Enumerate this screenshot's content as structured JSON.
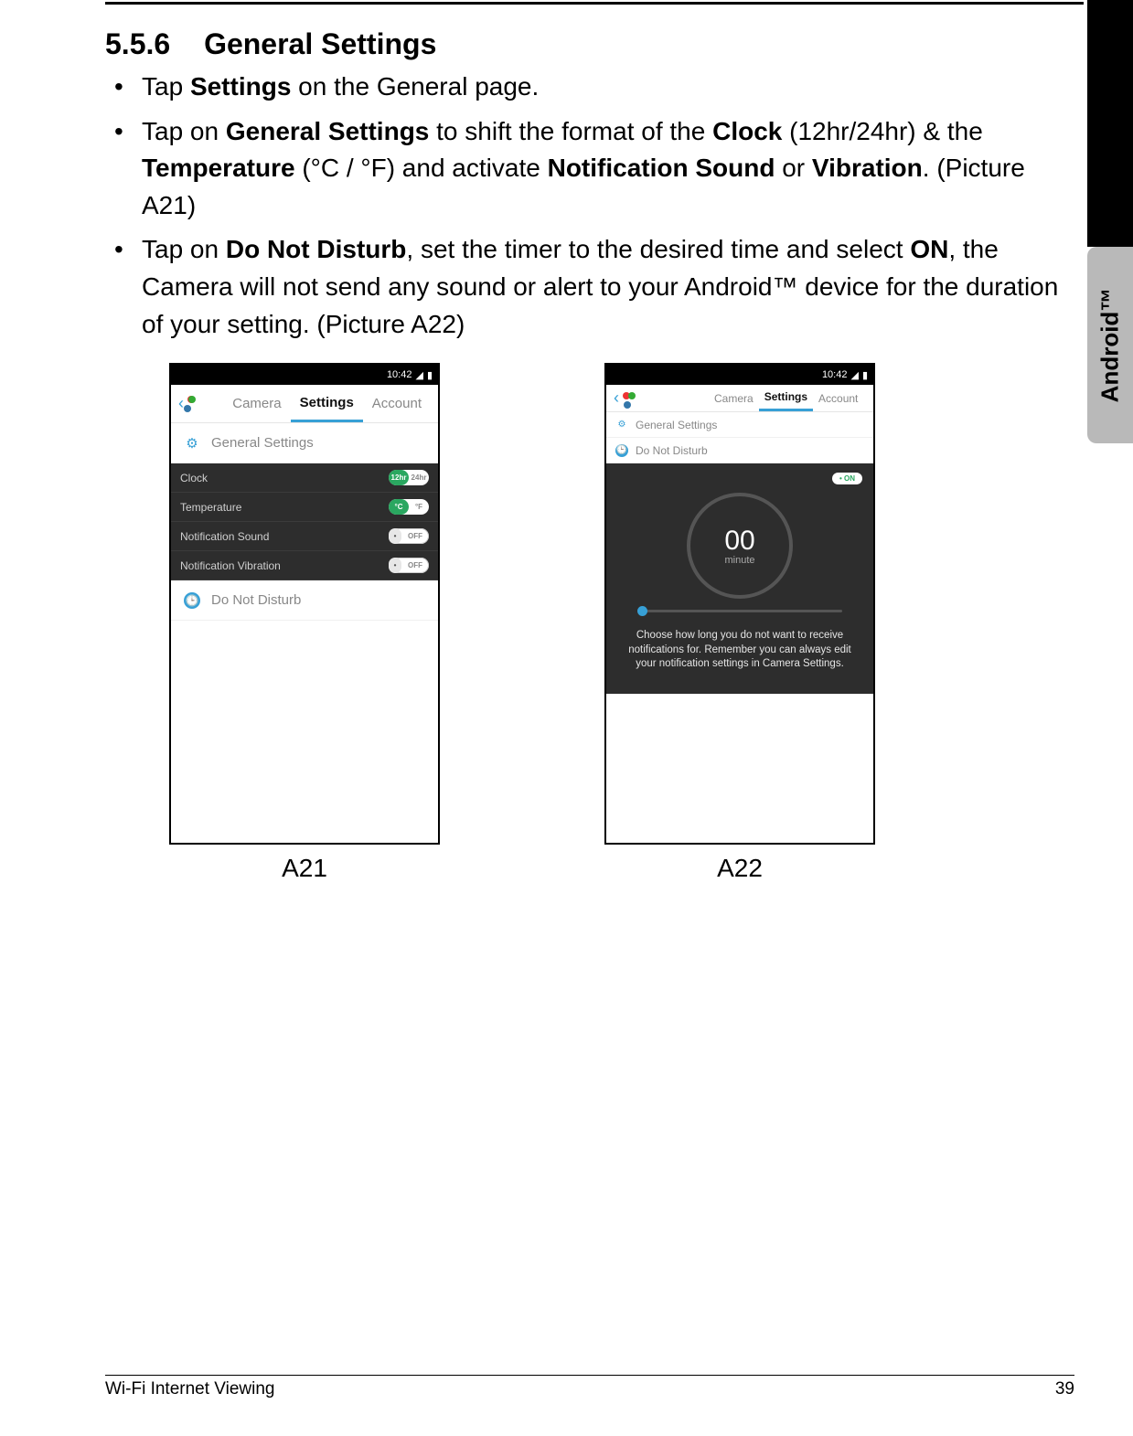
{
  "section": {
    "number": "5.5.6",
    "title": "General Settings"
  },
  "bullets": {
    "b1": {
      "pre": "Tap ",
      "bold1": "Settings",
      "post": " on the General page."
    },
    "b2": {
      "pre": "Tap on ",
      "bold1": "General Settings",
      "mid1": " to shift the format of the ",
      "bold2": "Clock",
      "mid2": " (12hr/24hr) & the ",
      "bold3": "Temperature",
      "mid3": " (°C / °F) and activate ",
      "bold4": "Notification Sound",
      "mid4": " or ",
      "bold5": "Vibration",
      "post": ". (Picture A21)"
    },
    "b3": {
      "pre": "Tap on ",
      "bold1": "Do Not Disturb",
      "mid1": ", set the timer to the desired time and select ",
      "bold2": "ON",
      "post": ", the Camera will not send any sound or alert to your Android™ device for the duration of your setting. (Picture A22)"
    }
  },
  "sideTab": "Android™",
  "phoneA21": {
    "time": "10:42",
    "tabs": {
      "camera": "Camera",
      "settings": "Settings",
      "account": "Account"
    },
    "generalSettings": "General Settings",
    "rows": {
      "clock": {
        "label": "Clock",
        "left": "12hr",
        "right": "24hr"
      },
      "temp": {
        "label": "Temperature",
        "left": "°C",
        "right": "°F"
      },
      "notifSound": {
        "label": "Notification Sound",
        "state": "OFF"
      },
      "notifVib": {
        "label": "Notification Vibration",
        "state": "OFF"
      }
    },
    "dnd": "Do Not Disturb",
    "figLabel": "A21"
  },
  "phoneA22": {
    "time": "10:42",
    "tabs": {
      "camera": "Camera",
      "settings": "Settings",
      "account": "Account"
    },
    "generalSettings": "General Settings",
    "dndRow": "Do Not Disturb",
    "onLabel": "• ON",
    "dial": {
      "value": "00",
      "unit": "minute"
    },
    "help": "Choose how long you do not want to receive notifications for. Remember you can always edit your notification settings in Camera Settings.",
    "figLabel": "A22"
  },
  "footer": {
    "left": "Wi-Fi Internet Viewing",
    "right": "39"
  }
}
